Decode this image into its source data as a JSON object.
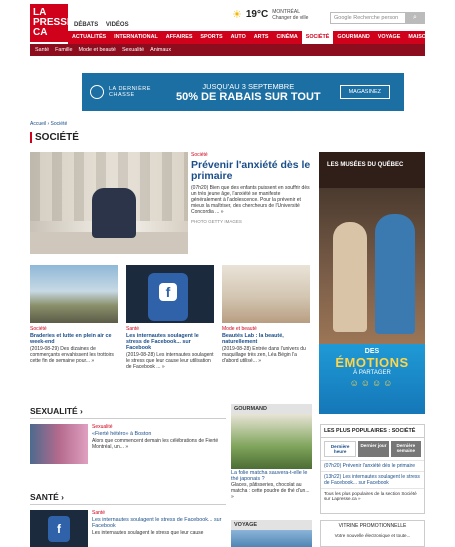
{
  "header": {
    "logo_text": "LA PRESSE CA",
    "top_links": [
      "DÉBATS",
      "VIDÉOS"
    ],
    "weather": {
      "temp": "19°C",
      "city": "MONTRÉAL",
      "change": "Changer de ville"
    },
    "search_placeholder": "Google Recherche person"
  },
  "main_nav": [
    "ACTUALITÉS",
    "INTERNATIONAL",
    "AFFAIRES",
    "SPORTS",
    "AUTO",
    "ARTS",
    "CINÉMA",
    "SOCIÉTÉ",
    "GOURMAND",
    "VOYAGE",
    "MAISON"
  ],
  "main_nav_active": "SOCIÉTÉ",
  "sub_nav": [
    "Santé",
    "Famille",
    "Mode et beauté",
    "Sexualité",
    "Animaux"
  ],
  "ad_banner": {
    "brand": "LA DERNIÈRE CHASSE",
    "line1": "JUSQU'AU 3 SEPTEMBRE",
    "line2": "50% DE RABAIS SUR TOUT",
    "button": "MAGASINEZ"
  },
  "breadcrumb": "Accueil › Société",
  "page_title": "SOCIÉTÉ",
  "hero": {
    "category": "Société",
    "headline": "Prévenir l'anxiété dès le primaire",
    "body": "(07h20) Bien que des enfants puissent en souffrir dès un très jeune âge, l'anxiété se manifeste généralement à l'adolescence. Pour la prévenir et mieux la maîtriser, des chercheurs de l'Université Concordia ... »",
    "credit": "PHOTO GETTY IMAGES"
  },
  "cards": [
    {
      "category": "Société",
      "headline": "Braderies et lutte en plein air ce week-end",
      "body": "(2019-08-29) Des dizaines de commerçants envahissent les trottoirs cette fin de semaine pour... »"
    },
    {
      "category": "Santé",
      "headline": "Les internautes soulagent le stress de Facebook... sur Facebook",
      "body": "(2019-08-28) Les internautes soulagent le stress que leur cause leur utilisation de Facebook ... »"
    },
    {
      "category": "Mode et beauté",
      "headline": "Beautés Lab : la beauté, naturellement",
      "body": "(2019-08-28) Entrée dans l'univers du maquillage très zen, Léa Bégin l'a d'abord utilisé... »"
    }
  ],
  "sexualite": {
    "title": "SEXUALITÉ ›",
    "category": "Sexualité",
    "headline": "«Fierté hétéro» à Boston",
    "body": "Alors que commencent demain les célébrations de Fierté Montréal, un... »"
  },
  "gourmand": {
    "title": "GOURMAND",
    "headline": "La folie matcha sauvera-t-elle le thé japonais ?",
    "body": "Glaces, pâtisseries, chocolat au matcha : cette poudre de thé d'un... »"
  },
  "sante": {
    "title": "SANTÉ ›",
    "category": "Santé",
    "headline": "Les internautes soulagent le stress de Facebook... sur Facebook",
    "body": "Les internautes soulagent le stress que leur cause"
  },
  "voyage": {
    "title": "VOYAGE"
  },
  "popular": {
    "title": "LES PLUS POPULAIRES : SOCIÉTÉ",
    "tabs": [
      "Dernière heure",
      "Dernier jour",
      "Dernière semaine"
    ],
    "items": [
      "(07h20) Prévenir l'anxiété dès le primaire",
      "(13h22) Les internautes soulagent le stress de Facebook... sur Facebook"
    ],
    "footer": "Tous les plus populaires de la section Société sur Lapresse.ca »"
  },
  "vitrine": {
    "title": "VITRINE PROMOTIONNELLE",
    "text": "Votre nouvelle électronique et toute..."
  },
  "right_ad": {
    "museum": "LES MUSÉES DU QUÉBEC",
    "des": "DES",
    "emotions": "ÉMOTIONS",
    "partager": "À PARTAGER"
  },
  "colors": {
    "brand_red": "#d0021b",
    "dark_red": "#8c0d1e",
    "link_blue": "#1a4e8a"
  }
}
